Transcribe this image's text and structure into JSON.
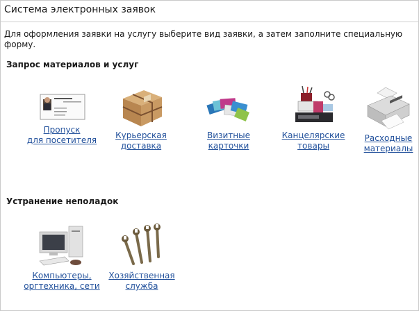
{
  "page": {
    "title": "Система электронных заявок",
    "intro": "Для оформления заявки на услугу выберите вид заявки, а затем заполните специальную форму."
  },
  "sections": [
    {
      "heading": "Запрос материалов и услуг",
      "items": [
        {
          "line1": "Пропуск",
          "line2": "для посетителя",
          "icon": "business-card-icon"
        },
        {
          "line1": "Курьерская",
          "line2": "доставка",
          "icon": "parcel-icon"
        },
        {
          "line1": "Визитные",
          "line2": "карточки",
          "icon": "cards-icon"
        },
        {
          "line1": "Канцелярские",
          "line2": "товары",
          "icon": "stationery-icon"
        },
        {
          "line1": "Расходные",
          "line2": "материалы",
          "icon": "printer-icon"
        }
      ]
    },
    {
      "heading": "Устранение неполадок",
      "items": [
        {
          "line1": "Компьютеры,",
          "line2": "оргтехника, сети",
          "icon": "computer-icon"
        },
        {
          "line1": "Хозяйственная",
          "line2": "служба",
          "icon": "wrenches-icon"
        }
      ]
    }
  ]
}
